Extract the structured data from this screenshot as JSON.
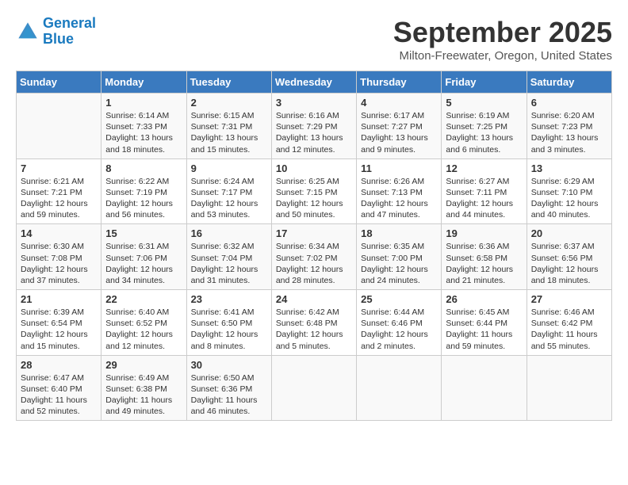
{
  "header": {
    "logo_line1": "General",
    "logo_line2": "Blue",
    "month_title": "September 2025",
    "location": "Milton-Freewater, Oregon, United States"
  },
  "days_of_week": [
    "Sunday",
    "Monday",
    "Tuesday",
    "Wednesday",
    "Thursday",
    "Friday",
    "Saturday"
  ],
  "weeks": [
    [
      {
        "day": "",
        "sunrise": "",
        "sunset": "",
        "daylight": ""
      },
      {
        "day": "1",
        "sunrise": "Sunrise: 6:14 AM",
        "sunset": "Sunset: 7:33 PM",
        "daylight": "Daylight: 13 hours and 18 minutes."
      },
      {
        "day": "2",
        "sunrise": "Sunrise: 6:15 AM",
        "sunset": "Sunset: 7:31 PM",
        "daylight": "Daylight: 13 hours and 15 minutes."
      },
      {
        "day": "3",
        "sunrise": "Sunrise: 6:16 AM",
        "sunset": "Sunset: 7:29 PM",
        "daylight": "Daylight: 13 hours and 12 minutes."
      },
      {
        "day": "4",
        "sunrise": "Sunrise: 6:17 AM",
        "sunset": "Sunset: 7:27 PM",
        "daylight": "Daylight: 13 hours and 9 minutes."
      },
      {
        "day": "5",
        "sunrise": "Sunrise: 6:19 AM",
        "sunset": "Sunset: 7:25 PM",
        "daylight": "Daylight: 13 hours and 6 minutes."
      },
      {
        "day": "6",
        "sunrise": "Sunrise: 6:20 AM",
        "sunset": "Sunset: 7:23 PM",
        "daylight": "Daylight: 13 hours and 3 minutes."
      }
    ],
    [
      {
        "day": "7",
        "sunrise": "Sunrise: 6:21 AM",
        "sunset": "Sunset: 7:21 PM",
        "daylight": "Daylight: 12 hours and 59 minutes."
      },
      {
        "day": "8",
        "sunrise": "Sunrise: 6:22 AM",
        "sunset": "Sunset: 7:19 PM",
        "daylight": "Daylight: 12 hours and 56 minutes."
      },
      {
        "day": "9",
        "sunrise": "Sunrise: 6:24 AM",
        "sunset": "Sunset: 7:17 PM",
        "daylight": "Daylight: 12 hours and 53 minutes."
      },
      {
        "day": "10",
        "sunrise": "Sunrise: 6:25 AM",
        "sunset": "Sunset: 7:15 PM",
        "daylight": "Daylight: 12 hours and 50 minutes."
      },
      {
        "day": "11",
        "sunrise": "Sunrise: 6:26 AM",
        "sunset": "Sunset: 7:13 PM",
        "daylight": "Daylight: 12 hours and 47 minutes."
      },
      {
        "day": "12",
        "sunrise": "Sunrise: 6:27 AM",
        "sunset": "Sunset: 7:11 PM",
        "daylight": "Daylight: 12 hours and 44 minutes."
      },
      {
        "day": "13",
        "sunrise": "Sunrise: 6:29 AM",
        "sunset": "Sunset: 7:10 PM",
        "daylight": "Daylight: 12 hours and 40 minutes."
      }
    ],
    [
      {
        "day": "14",
        "sunrise": "Sunrise: 6:30 AM",
        "sunset": "Sunset: 7:08 PM",
        "daylight": "Daylight: 12 hours and 37 minutes."
      },
      {
        "day": "15",
        "sunrise": "Sunrise: 6:31 AM",
        "sunset": "Sunset: 7:06 PM",
        "daylight": "Daylight: 12 hours and 34 minutes."
      },
      {
        "day": "16",
        "sunrise": "Sunrise: 6:32 AM",
        "sunset": "Sunset: 7:04 PM",
        "daylight": "Daylight: 12 hours and 31 minutes."
      },
      {
        "day": "17",
        "sunrise": "Sunrise: 6:34 AM",
        "sunset": "Sunset: 7:02 PM",
        "daylight": "Daylight: 12 hours and 28 minutes."
      },
      {
        "day": "18",
        "sunrise": "Sunrise: 6:35 AM",
        "sunset": "Sunset: 7:00 PM",
        "daylight": "Daylight: 12 hours and 24 minutes."
      },
      {
        "day": "19",
        "sunrise": "Sunrise: 6:36 AM",
        "sunset": "Sunset: 6:58 PM",
        "daylight": "Daylight: 12 hours and 21 minutes."
      },
      {
        "day": "20",
        "sunrise": "Sunrise: 6:37 AM",
        "sunset": "Sunset: 6:56 PM",
        "daylight": "Daylight: 12 hours and 18 minutes."
      }
    ],
    [
      {
        "day": "21",
        "sunrise": "Sunrise: 6:39 AM",
        "sunset": "Sunset: 6:54 PM",
        "daylight": "Daylight: 12 hours and 15 minutes."
      },
      {
        "day": "22",
        "sunrise": "Sunrise: 6:40 AM",
        "sunset": "Sunset: 6:52 PM",
        "daylight": "Daylight: 12 hours and 12 minutes."
      },
      {
        "day": "23",
        "sunrise": "Sunrise: 6:41 AM",
        "sunset": "Sunset: 6:50 PM",
        "daylight": "Daylight: 12 hours and 8 minutes."
      },
      {
        "day": "24",
        "sunrise": "Sunrise: 6:42 AM",
        "sunset": "Sunset: 6:48 PM",
        "daylight": "Daylight: 12 hours and 5 minutes."
      },
      {
        "day": "25",
        "sunrise": "Sunrise: 6:44 AM",
        "sunset": "Sunset: 6:46 PM",
        "daylight": "Daylight: 12 hours and 2 minutes."
      },
      {
        "day": "26",
        "sunrise": "Sunrise: 6:45 AM",
        "sunset": "Sunset: 6:44 PM",
        "daylight": "Daylight: 11 hours and 59 minutes."
      },
      {
        "day": "27",
        "sunrise": "Sunrise: 6:46 AM",
        "sunset": "Sunset: 6:42 PM",
        "daylight": "Daylight: 11 hours and 55 minutes."
      }
    ],
    [
      {
        "day": "28",
        "sunrise": "Sunrise: 6:47 AM",
        "sunset": "Sunset: 6:40 PM",
        "daylight": "Daylight: 11 hours and 52 minutes."
      },
      {
        "day": "29",
        "sunrise": "Sunrise: 6:49 AM",
        "sunset": "Sunset: 6:38 PM",
        "daylight": "Daylight: 11 hours and 49 minutes."
      },
      {
        "day": "30",
        "sunrise": "Sunrise: 6:50 AM",
        "sunset": "Sunset: 6:36 PM",
        "daylight": "Daylight: 11 hours and 46 minutes."
      },
      {
        "day": "",
        "sunrise": "",
        "sunset": "",
        "daylight": ""
      },
      {
        "day": "",
        "sunrise": "",
        "sunset": "",
        "daylight": ""
      },
      {
        "day": "",
        "sunrise": "",
        "sunset": "",
        "daylight": ""
      },
      {
        "day": "",
        "sunrise": "",
        "sunset": "",
        "daylight": ""
      }
    ]
  ]
}
